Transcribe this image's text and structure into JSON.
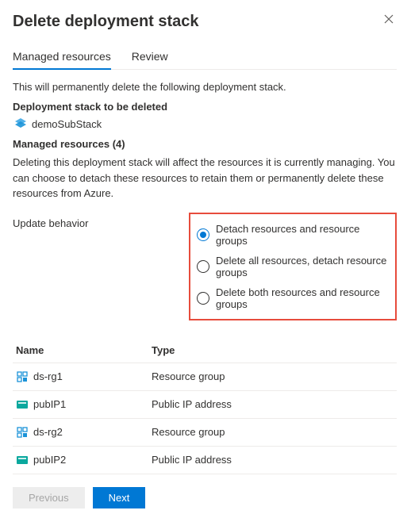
{
  "header": {
    "title": "Delete deployment stack"
  },
  "tabs": {
    "managed": "Managed resources",
    "review": "Review"
  },
  "intro": "This will permanently delete the following deployment stack.",
  "stack_section": {
    "heading": "Deployment stack to be deleted",
    "stack_name": "demoSubStack"
  },
  "managed_section": {
    "heading": "Managed resources (4)",
    "description": "Deleting this deployment stack will affect the resources it is currently managing. You can choose to detach these resources to retain them or permanently delete these resources from Azure."
  },
  "behavior": {
    "label": "Update behavior",
    "options": [
      "Detach resources and resource groups",
      "Delete all resources, detach resource groups",
      "Delete both resources and resource groups"
    ],
    "selected_index": 0
  },
  "table": {
    "columns": {
      "name": "Name",
      "type": "Type"
    },
    "rows": [
      {
        "name": "ds-rg1",
        "type": "Resource group",
        "icon": "rg"
      },
      {
        "name": "pubIP1",
        "type": "Public IP address",
        "icon": "pip"
      },
      {
        "name": "ds-rg2",
        "type": "Resource group",
        "icon": "rg"
      },
      {
        "name": "pubIP2",
        "type": "Public IP address",
        "icon": "pip"
      }
    ]
  },
  "footer": {
    "previous": "Previous",
    "next": "Next"
  }
}
